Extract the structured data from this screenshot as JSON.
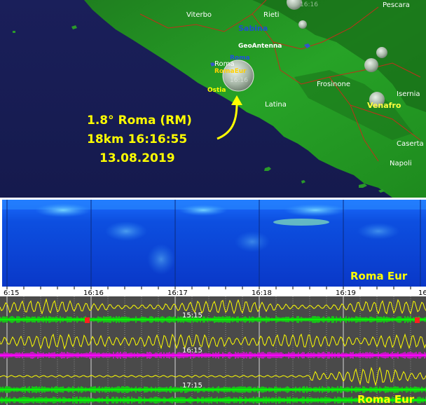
{
  "map": {
    "cities": [
      {
        "name": "Viterbo",
        "color": "#ffffff"
      },
      {
        "name": "Rieti",
        "color": "#ffffff"
      },
      {
        "name": "Pescara",
        "color": "#ffffff"
      },
      {
        "name": "Sabina",
        "color": "#1f4fd0"
      },
      {
        "name": "GeoAntenna",
        "color": "#ffffff"
      },
      {
        "name": "Roma",
        "color": "#2050e0"
      },
      {
        "name": "Roma",
        "color": "#ffffff"
      },
      {
        "name": "RomaEur",
        "color": "#ffd000"
      },
      {
        "name": "Ostia",
        "color": "#ffff00"
      },
      {
        "name": "Frosinone",
        "color": "#ffffff"
      },
      {
        "name": "Latina",
        "color": "#ffffff"
      },
      {
        "name": "Isernia",
        "color": "#ffffff"
      },
      {
        "name": "Venafro",
        "color": "#ffff40"
      },
      {
        "name": "Caserta",
        "color": "#ffffff"
      },
      {
        "name": "Napoli",
        "color": "#ffffff"
      }
    ],
    "quake_times": [
      "16:16",
      "16:16"
    ],
    "event": {
      "line1": "1.8° Roma (RM)",
      "line2": "18km 16:16:55",
      "line3": "13.08.2019",
      "color": "#ffff00"
    }
  },
  "spectrogram": {
    "station": "Roma Eur",
    "time_ticks": [
      "6:15",
      "16:16",
      "16:17",
      "16:18",
      "16:19",
      "16"
    ]
  },
  "seismo": {
    "track_labels": [
      "15:15",
      "16:15",
      "17:15"
    ],
    "station": "Roma Eur",
    "trace_colors": {
      "signal": "#ffff00",
      "green": "#00ff00",
      "magenta": "#ff00ff"
    }
  }
}
